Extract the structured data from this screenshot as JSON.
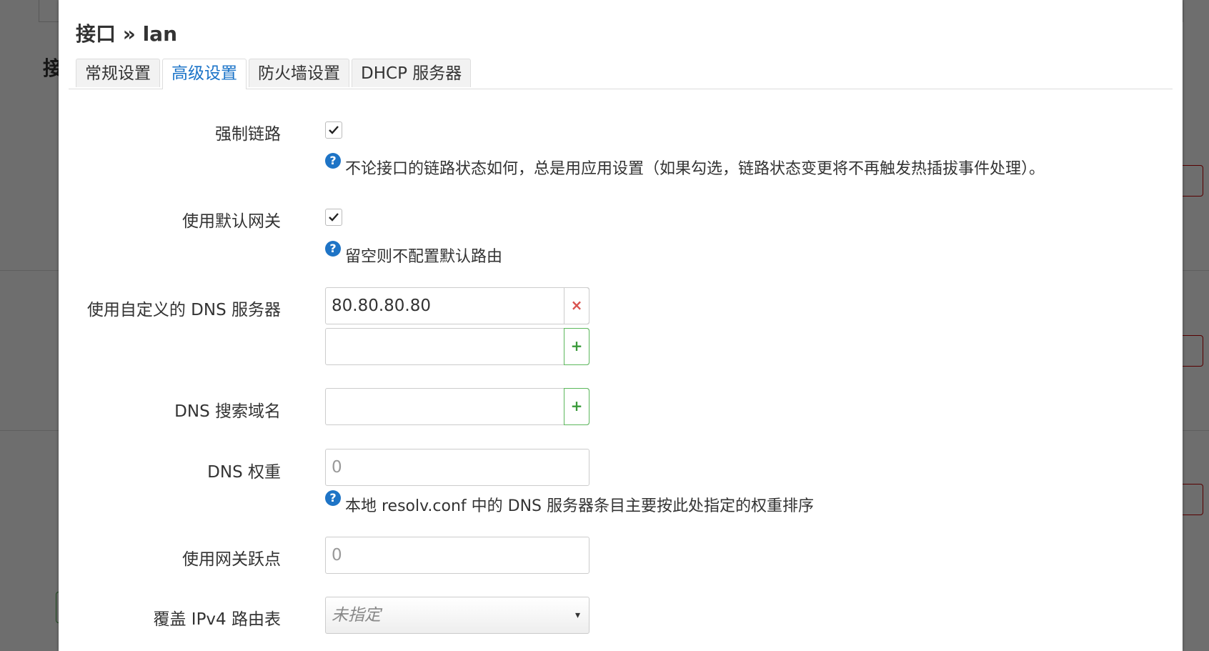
{
  "background": {
    "heading": "接"
  },
  "modal": {
    "title": "接口 » lan",
    "tabs": [
      "常规设置",
      "高级设置",
      "防火墙设置",
      "DHCP 服务器"
    ],
    "active_tab": "高级设置"
  },
  "form": {
    "force_link": {
      "label": "强制链路",
      "checked": true,
      "help": "不论接口的链路状态如何，总是用应用设置（如果勾选，链路状态变更将不再触发热插拔事件处理）。"
    },
    "default_gateway": {
      "label": "使用默认网关",
      "checked": true,
      "help": "留空则不配置默认路由"
    },
    "custom_dns": {
      "label": "使用自定义的 DNS 服务器",
      "values": [
        "80.80.80.80",
        ""
      ],
      "remove_symbol": "×",
      "add_symbol": "+"
    },
    "dns_search": {
      "label": "DNS 搜索域名",
      "value": "",
      "add_symbol": "+"
    },
    "dns_weight": {
      "label": "DNS 权重",
      "placeholder": "0",
      "help": "本地 resolv.conf 中的 DNS 服务器条目主要按此处指定的权重排序"
    },
    "gateway_metric": {
      "label": "使用网关跃点",
      "placeholder": "0"
    },
    "ipv4_table": {
      "label": "覆盖 IPv4 路由表",
      "selected": "未指定"
    }
  },
  "icons": {
    "help": "?",
    "caret": "▾"
  },
  "colors": {
    "accent": "#1a73c8",
    "help_icon": "#1e74c6",
    "remove": "#d9534f",
    "add": "#5cb85c"
  }
}
